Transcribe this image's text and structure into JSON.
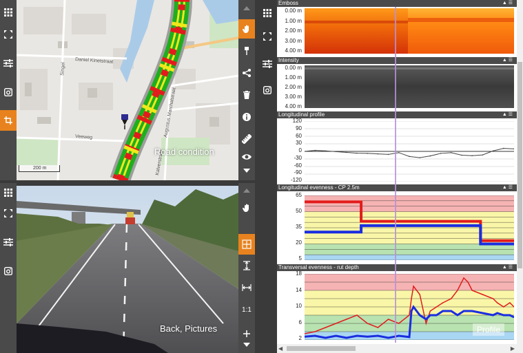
{
  "map": {
    "label": "Road condition",
    "scale": "200 m",
    "streets": [
      "Daniel Kinetstraat",
      "Singel",
      "Veeweg",
      "Augustus Marchalstraat",
      "Kalverstraat"
    ],
    "condition_colors": {
      "good": "#1fae1f",
      "fair": "#f1e81a",
      "poor": "#e21c1c"
    }
  },
  "camera": {
    "label": "Back, Pictures"
  },
  "left_toolbar_top": {
    "items": [
      "grid-icon",
      "expand-icon",
      "sliders-icon",
      "camera-icon",
      "crop-icon"
    ]
  },
  "left_toolbar_bottom": {
    "items": [
      "grid-icon",
      "expand-icon",
      "sliders-icon",
      "camera-icon"
    ]
  },
  "map_tools": {
    "items": [
      "hand-icon",
      "pin-icon",
      "share-icon",
      "trash-icon",
      "info-icon",
      "ruler-icon",
      "eye-icon"
    ]
  },
  "camera_tools": {
    "items": [
      "hand-icon",
      "move-icon",
      "fit-height-icon",
      "fit-width-icon"
    ],
    "one_to_one": "1:1"
  },
  "profile": {
    "label": "Profile"
  },
  "panels": {
    "emboss": {
      "title": "Emboss",
      "ticks": [
        "0.00 m",
        "1.00 m",
        "2.00 m",
        "3.00 m",
        "4.00 m"
      ]
    },
    "intensity": {
      "title": "Intensity",
      "ticks": [
        "0.00 m",
        "1.00 m",
        "2.00 m",
        "3.00 m",
        "4.00 m"
      ]
    },
    "longitudinal_profile": {
      "title": "Longitudinal profile",
      "ticks": [
        "120",
        "90",
        "60",
        "30",
        "0",
        "-30",
        "-60",
        "-90",
        "-120"
      ]
    },
    "longitudinal_evenness": {
      "title": "Longitudinal evenness - CP 2.5m",
      "ticks": [
        "65",
        "50",
        "35",
        "20",
        "5"
      ]
    },
    "transversal_evenness": {
      "title": "Transversal evenness - rut depth",
      "ticks": [
        "18",
        "14",
        "10",
        "6",
        "2"
      ]
    }
  },
  "chart_data": [
    {
      "type": "line",
      "title": "Longitudinal profile",
      "ylim": [
        -120,
        120
      ],
      "x": [
        0,
        5,
        10,
        15,
        20,
        25,
        30,
        35,
        40,
        45,
        50,
        55,
        60,
        65,
        70,
        75,
        80,
        85,
        90,
        95,
        100
      ],
      "series": [
        {
          "values": [
            0,
            4,
            2,
            -1,
            -4,
            -7,
            -8,
            -10,
            -12,
            -5,
            -20,
            -25,
            -18,
            -8,
            -5,
            -15,
            -17,
            -14,
            2,
            12,
            10
          ]
        }
      ]
    },
    {
      "type": "line",
      "title": "Longitudinal evenness - CP 2.5m",
      "ylim": [
        5,
        65
      ],
      "x": [
        0,
        27,
        27,
        84,
        84,
        100
      ],
      "series": [
        {
          "values": [
            59,
            59,
            41,
            41,
            23,
            23
          ]
        },
        {
          "values": [
            31,
            31,
            37,
            37,
            20,
            20
          ]
        }
      ]
    },
    {
      "type": "line",
      "title": "Transversal evenness - rut depth",
      "ylim": [
        2,
        18
      ],
      "x": [
        0,
        5,
        10,
        15,
        20,
        25,
        30,
        35,
        40,
        45,
        50,
        51,
        52,
        55,
        58,
        60,
        63,
        66,
        70,
        73,
        76,
        78,
        80,
        85,
        90,
        92,
        95,
        98,
        100
      ],
      "series": [
        {
          "values": [
            3.5,
            4,
            5,
            6,
            7,
            8,
            6,
            5,
            7,
            6,
            8,
            12,
            15,
            13,
            6,
            9,
            10,
            11,
            12,
            14,
            17,
            16,
            14,
            13,
            12,
            11,
            10,
            11,
            10
          ]
        },
        {
          "values": [
            2.8,
            3,
            2.5,
            3,
            2.5,
            3,
            2.8,
            3,
            2.5,
            3,
            2.7,
            9,
            10,
            8,
            7,
            8,
            8,
            9,
            9,
            8,
            9,
            9,
            9,
            8.5,
            8,
            8.5,
            8,
            8,
            7.5
          ]
        }
      ]
    }
  ]
}
